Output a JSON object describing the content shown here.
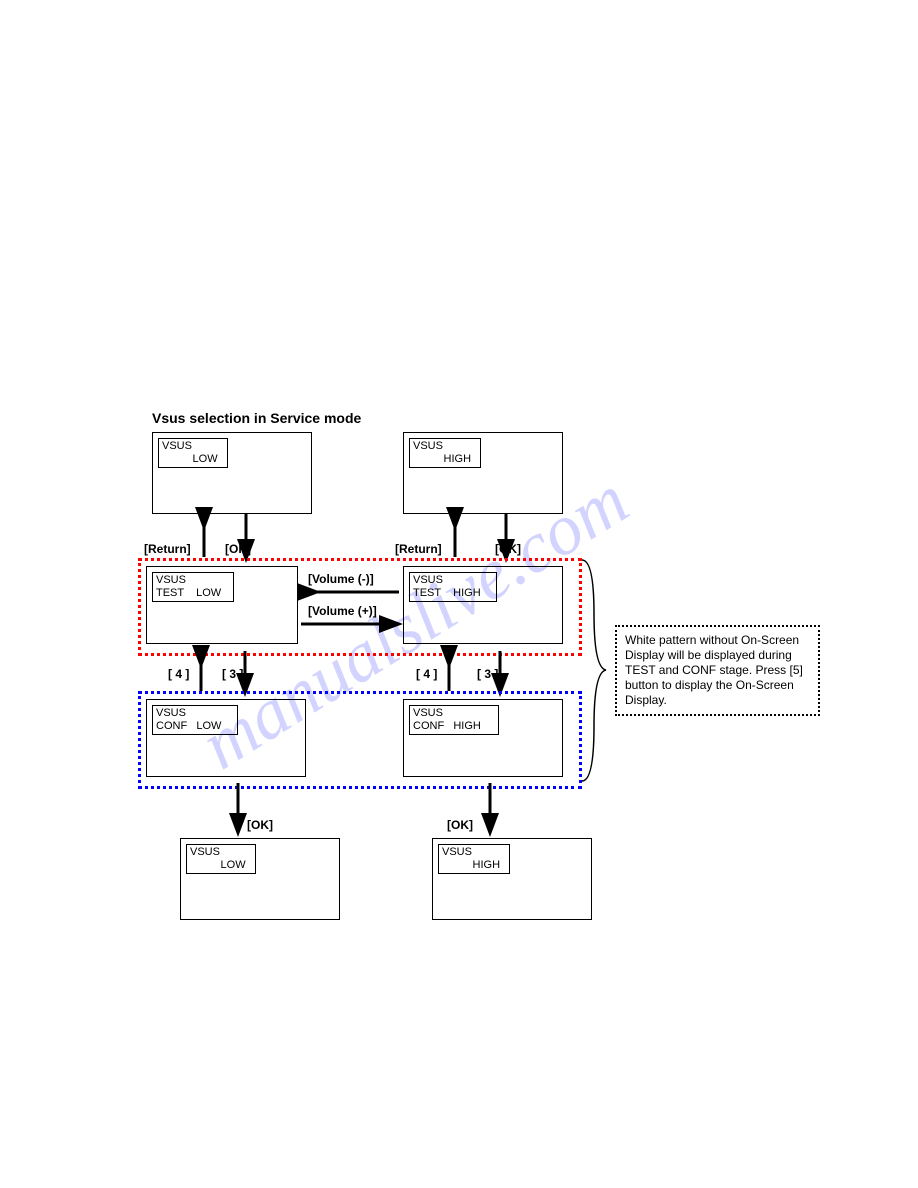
{
  "watermark": "manualslive.com",
  "title": "Vsus selection in Service mode",
  "screens": {
    "topLeft": {
      "line1": "VSUS",
      "line2": "          LOW"
    },
    "topRight": {
      "line1": "VSUS",
      "line2": "          HIGH"
    },
    "testLeft": {
      "line1": "VSUS",
      "line2": "TEST    LOW"
    },
    "testRight": {
      "line1": "VSUS",
      "line2": "TEST    HIGH"
    },
    "confLeft": {
      "line1": "VSUS",
      "line2": "CONF   LOW"
    },
    "confRight": {
      "line1": "VSUS",
      "line2": "CONF   HIGH"
    },
    "botLeft": {
      "line1": "VSUS",
      "line2": "          LOW"
    },
    "botRight": {
      "line1": "VSUS",
      "line2": "          HIGH"
    }
  },
  "labels": {
    "return1": "[Return]",
    "ok1": "[OK]",
    "return2": "[Return]",
    "ok2": "[OK]",
    "volMinus": "[Volume (-)]",
    "volPlus": "[Volume (+)]",
    "k4a": "[ 4 ]",
    "k3a": "[ 3 ]",
    "k4b": "[ 4 ]",
    "k3b": "[ 3 ]",
    "ok3": "[OK]",
    "ok4": "[OK]"
  },
  "info": "White pattern without On-Screen Display will be displayed during TEST and CONF stage. Press [5] button to display the On-Screen Display."
}
